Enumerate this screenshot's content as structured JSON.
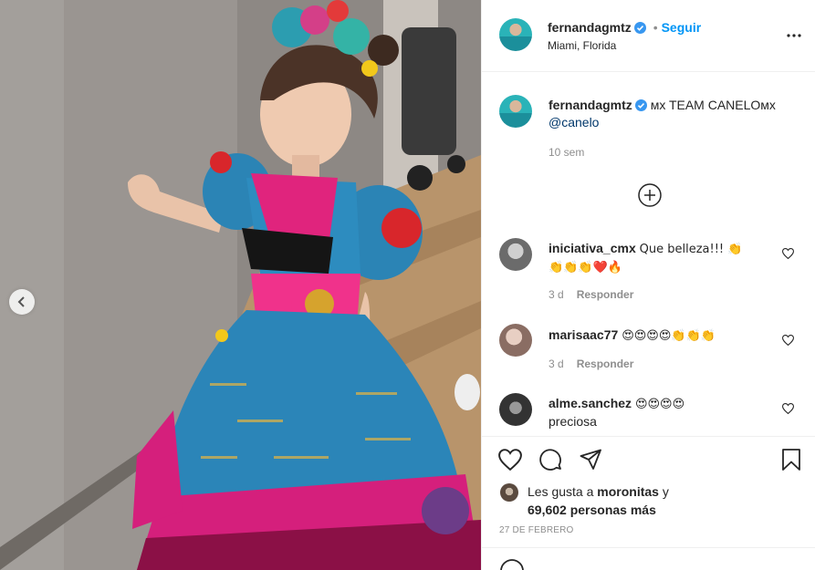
{
  "post": {
    "owner": "fernandagmtz",
    "location": "Miami, Florida",
    "follow_label": "Seguir",
    "separator": "•",
    "caption_text": "ᴍx TEAM CANELOᴍx",
    "caption_mention": "@canelo",
    "caption_time": "10 sem"
  },
  "comments": [
    {
      "user": "iniciativa_cmx",
      "text": "Que belleza!!! 👏",
      "text2": "👏👏👏❤️🔥",
      "time": "3 d",
      "reply": "Responder"
    },
    {
      "user": "marisaac77",
      "text": "😍😍😍😍👏👏👏",
      "time": "3 d",
      "reply": "Responder"
    },
    {
      "user": "alme.sanchez",
      "text": "😍😍😍😍",
      "text2": "preciosa"
    }
  ],
  "likes": {
    "prefix": "Les gusta a",
    "user": "moronitas",
    "conj": "y",
    "count": "69,602 personas más"
  },
  "date": "27 DE FEBRERO",
  "colors": {
    "accent": "#0095f6",
    "verified": "#3897f0",
    "text": "#262626",
    "muted": "#8e8e8e"
  }
}
